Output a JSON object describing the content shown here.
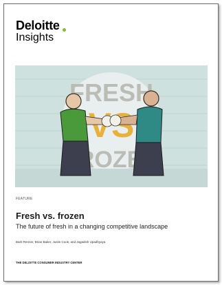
{
  "logo": {
    "brand": "Deloitte",
    "product": "Insights"
  },
  "hero": {
    "word_top": "FRESH",
    "word_middle": "VS",
    "word_bottom": "FROZEN"
  },
  "article": {
    "label": "FEATURE",
    "title": "Fresh vs. frozen",
    "subtitle": "The future of fresh in a changing competitive landscape",
    "authors": "Barb Renner, Brian Baker, Justin Cook, and Jagadish Upadhyaya",
    "publisher": "THE DELOITTE CONSUMER INDUSTRY CENTER"
  },
  "colors": {
    "brand_green": "#86bc25",
    "hero_background": "#cfe1de",
    "vs_gold": "#e8b23a"
  }
}
